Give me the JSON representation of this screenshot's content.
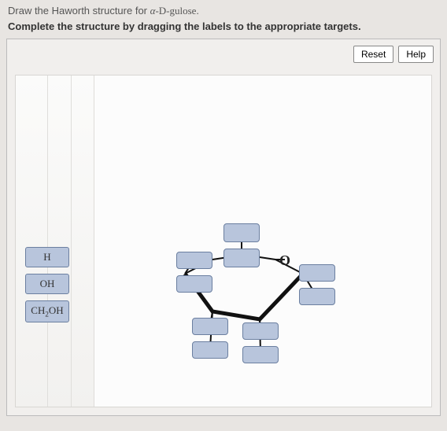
{
  "prompt": {
    "part1": "Draw the Haworth structure for ",
    "alpha": "α",
    "tail": "-D-gulose.",
    "line2": "Complete the structure by dragging the labels to the appropriate targets."
  },
  "buttons": {
    "reset": "Reset",
    "help": "Help"
  },
  "ring": {
    "oxygen": "O"
  },
  "palette": {
    "items": [
      {
        "html": "H"
      },
      {
        "html": "OH"
      },
      {
        "html": "CH<sub>2</sub>OH"
      }
    ]
  }
}
